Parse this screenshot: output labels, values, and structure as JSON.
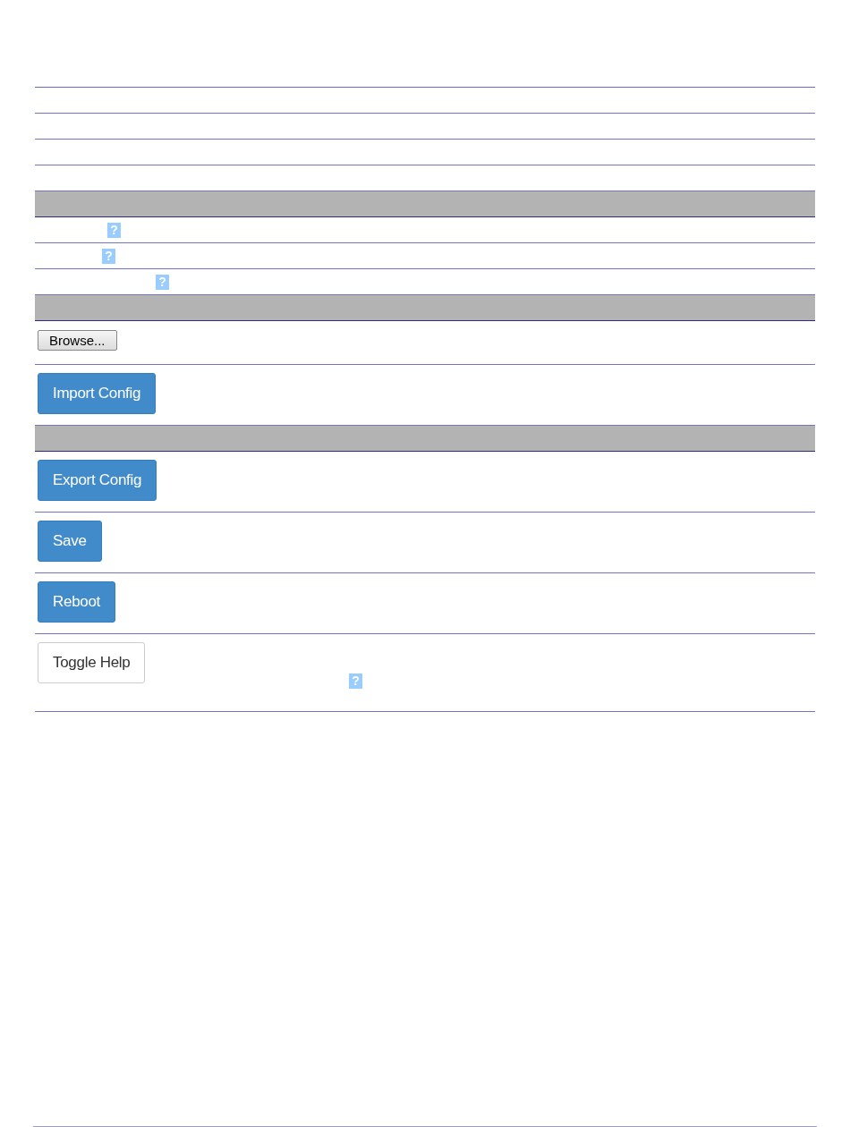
{
  "rows": [
    {
      "kind": "blank"
    },
    {
      "kind": "blank"
    },
    {
      "kind": "blank"
    },
    {
      "kind": "blank"
    },
    {
      "kind": "section"
    },
    {
      "kind": "help",
      "help": "?"
    },
    {
      "kind": "help",
      "help": "?"
    },
    {
      "kind": "help",
      "help": "?"
    },
    {
      "kind": "section"
    },
    {
      "kind": "file",
      "button": "Browse..."
    },
    {
      "kind": "button",
      "label": "Import Config"
    },
    {
      "kind": "section"
    },
    {
      "kind": "button",
      "label": "Export Config"
    },
    {
      "kind": "button",
      "label": "Save"
    },
    {
      "kind": "button",
      "label": "Reboot"
    },
    {
      "kind": "toggle",
      "label": "Toggle Help",
      "help": "?"
    }
  ]
}
